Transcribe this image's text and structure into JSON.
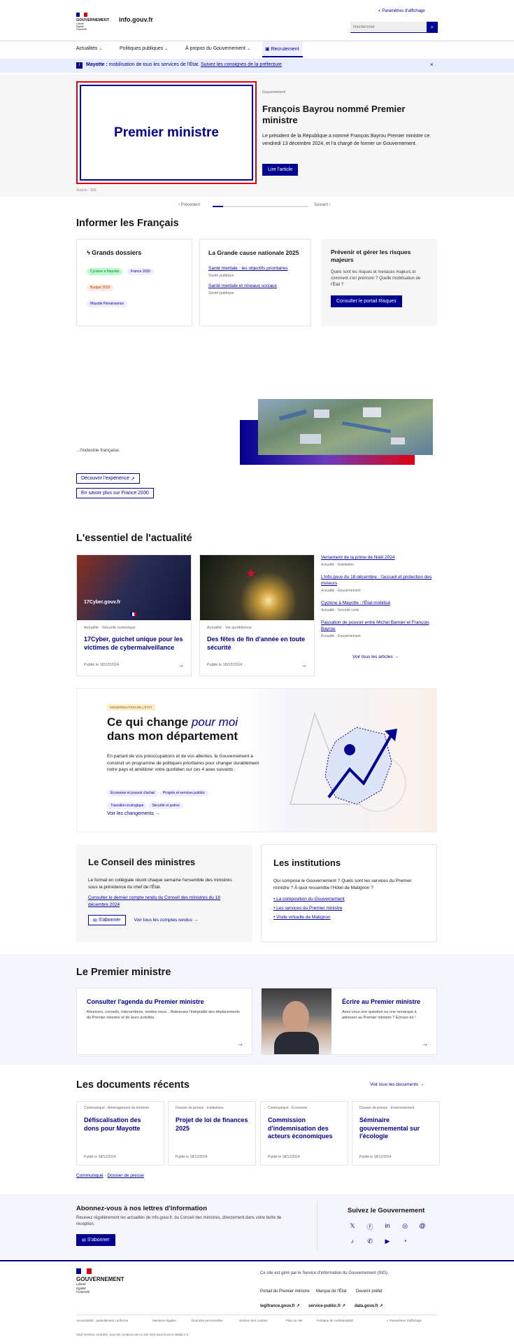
{
  "header": {
    "site_name": "info.gouv.fr",
    "logo_text": "GOUVERNEMENT",
    "logo_motto": "Liberté\nÉgalité\nFraternité",
    "display_settings": "Paramètres d'affichage",
    "search_placeholder": "Rechercher"
  },
  "nav": {
    "items": [
      "Actualités",
      "Politiques publiques",
      "À propos du Gouvernement",
      "Recrutement"
    ]
  },
  "alert": {
    "label": "Mayotte :",
    "text": " mobilisation de tous les services de l'État.",
    "link": "Suivez les consignes de la préfecture"
  },
  "hero": {
    "image_text": "Premier ministre",
    "kicker": "Gouvernement",
    "title": "François Bayrou nommé Premier ministre",
    "desc": "Le président de la République a nommé François Bayrou Premier ministre ce vendredi 13 décembre 2024, et l'a chargé de former un Gouvernement.",
    "cta": "Lire l'article",
    "credit": "Source : SIG",
    "prev": "Précédent",
    "next": "Suivant"
  },
  "informer": {
    "title": "Informer les Français",
    "dossiers": {
      "title": "Grands dossiers",
      "tags": [
        "Cyclone à Mayotte",
        "France 2030",
        "Budget 2025",
        "Mayotte Renaissance"
      ]
    },
    "cause": {
      "title": "La Grande cause nationale 2025",
      "links": [
        {
          "text": "Santé mentale : les objectifs prioritaires",
          "meta": "Santé publique"
        },
        {
          "text": "Santé mentale et réseaux sociaux",
          "meta": "Santé publique"
        }
      ]
    },
    "risques": {
      "title": "Prévenir et gérer les risques majeurs",
      "desc": "Quels sont les risques et menaces majeurs et comment s'en prémunir ? Quelle mobilisation de l'État ?",
      "cta": "Consulter le portail Risques"
    }
  },
  "france2030": {
    "text": "...l'industrie française.",
    "cta1": "Découvrir l'expérience",
    "cta2": "En savoir plus sur France 2030"
  },
  "actu": {
    "title": "L'essentiel de l'actualité",
    "cards": [
      {
        "cat": "Actualité · Sécurité numérique",
        "title": "17Cyber, guichet unique pour les victimes de cybermalveillance",
        "date": "Publié le 18/12/2024",
        "img_text": "17Cyber.gouv.fr"
      },
      {
        "cat": "Actualité · Vie quotidienne",
        "title": "Des fêtes de fin d'année en toute sécurité",
        "date": "Publié le 18/12/2024"
      }
    ],
    "list": [
      {
        "text": "Versement de la prime de Noël 2024",
        "meta": "Actualité · Solidarités"
      },
      {
        "text": "L'info.gouv du 18 décembre : l'accueil et protection des mineurs",
        "meta": "Actualité · Gouvernement"
      },
      {
        "text": "Cyclone à Mayotte : l'État mobilisé",
        "meta": "Actualité · Sécurité civile"
      },
      {
        "text": "Passation de pouvoir entre Michel Barnier et François Bayrou",
        "meta": "Actualité · Gouvernement"
      }
    ],
    "all_link": "Voir tous les articles"
  },
  "change": {
    "badge": "MODERNISATION DE L'ÉTAT",
    "title_a": "Ce qui change ",
    "title_em": "pour moi",
    "title_b": "dans mon département",
    "desc": "En partant de vos préoccupations et de vos attentes, le Gouvernement a construit un programme de politiques prioritaires pour changer durablement notre pays et améliorer votre quotidien sur ces 4 axes suivants :",
    "tags": [
      "Économie et pouvoir d'achat",
      "Progrès et services publics",
      "Transition écologique",
      "Sécurité et justice"
    ],
    "link": "Voir les changements"
  },
  "conseil": {
    "title": "Le Conseil des ministres",
    "desc": "Le format en collégiale réunit chaque semaine l'ensemble des ministres sous la présidence du chef de l'État.",
    "link": "Consulter le dernier compte rendu du Conseil des ministres du 18 décembre 2024",
    "btn": "S'abonner",
    "link2": "Voir tous les comptes rendus"
  },
  "institutions": {
    "title": "Les institutions",
    "desc": "Qui compose le Gouvernement ? Quels sont les services du Premier ministre ? À quoi ressemble l'Hôtel de Matignon ?",
    "links": [
      "La composition du Gouvernement",
      "Les services du Premier ministre",
      "Visite virtuelle de Matignon"
    ]
  },
  "pm": {
    "title": "Le Premier ministre",
    "agenda_title": "Consulter l'agenda du Premier ministre",
    "agenda_desc": "Réunions, conseils, interventions, rendez-vous... Retrouvez l'intégralité des déplacements du Premier ministre et de leurs activités.",
    "write_title": "Écrire au Premier ministre",
    "write_desc": "Avez-vous une question ou une remarque à adresser au Premier ministre ? Écrivez-lui !"
  },
  "docs": {
    "title": "Les documents récents",
    "all_link": "Voir tous les documents",
    "items": [
      {
        "cat": "Communiqué · Aménagement du territoire",
        "title": "Défiscalisation des dons pour Mayotte",
        "date": "Publié le 18/12/2024"
      },
      {
        "cat": "Dossier de presse · Institutions",
        "title": "Projet de loi de finances 2025",
        "date": "Publié le 18/12/2024"
      },
      {
        "cat": "Communiqué · Économie",
        "title": "Commission d'indemnisation des acteurs économiques",
        "date": "Publié le 18/12/2024"
      },
      {
        "cat": "Dossier de presse · Environnement",
        "title": "Séminaire gouvernemental sur l'écologie",
        "date": "Publié le 18/12/2024"
      }
    ],
    "filters": [
      "Communiqué",
      "Dossier de presse"
    ]
  },
  "newsletter": {
    "title": "Abonnez-vous à nos lettres d'information",
    "desc": "Recevez régulièrement les actualités de info.gouv.fr, du Conseil des ministres, directement dans votre boîte de réception.",
    "btn": "S'abonner",
    "follow": "Suivez le Gouvernement"
  },
  "footer": {
    "logo_text": "GOUVERNEMENT",
    "logo_motto": "Liberté\nÉgalité\nFraternité",
    "desc": "Ce site est géré par le Service d'information du Gouvernement (SIG).",
    "links_top": [
      "Portail du Premier ministre",
      "Marque de l'État",
      "Devenir préfet"
    ],
    "links_mid": [
      "legifrance.gouv.fr",
      "service-public.fr",
      "data.gouv.fr"
    ],
    "links_bottom": [
      "Accessibilité : partiellement conforme",
      "Mentions légales",
      "Données personnelles",
      "Gestion des cookies",
      "Plan du site",
      "Politique de confidentialité"
    ],
    "settings": "Paramètres d'affichage",
    "license": "Sauf mention contraire, tous les contenus de ce site sont sous licence etalab-2.0"
  }
}
